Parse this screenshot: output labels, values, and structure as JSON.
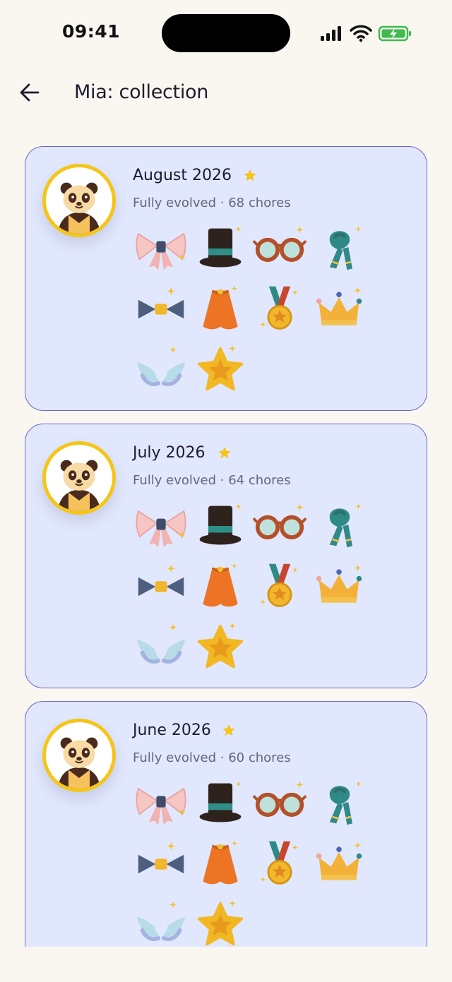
{
  "status_bar": {
    "time": "09:41"
  },
  "header": {
    "title": "Mia: collection"
  },
  "cards": [
    {
      "title": "August 2026",
      "subtitle": "Fully evolved · 68 chores",
      "avatar": "panda-icon",
      "featured": true
    },
    {
      "title": "July 2026",
      "subtitle": "Fully evolved · 64 chores",
      "avatar": "panda-icon",
      "featured": true
    },
    {
      "title": "June 2026",
      "subtitle": "Fully evolved · 60 chores",
      "avatar": "panda-icon",
      "featured": true
    }
  ],
  "items": [
    "pink-bow-icon",
    "top-hat-icon",
    "glasses-icon",
    "scarf-icon",
    "bow-tie-icon",
    "cape-icon",
    "medal-icon",
    "crown-icon",
    "wings-icon",
    "star-icon"
  ],
  "colors": {
    "background": "#faf7f1",
    "card_fill": "#e1e7fc",
    "card_border": "#6b64d6",
    "avatar_ring": "#f5c518",
    "accent_star": "#f5c518"
  }
}
